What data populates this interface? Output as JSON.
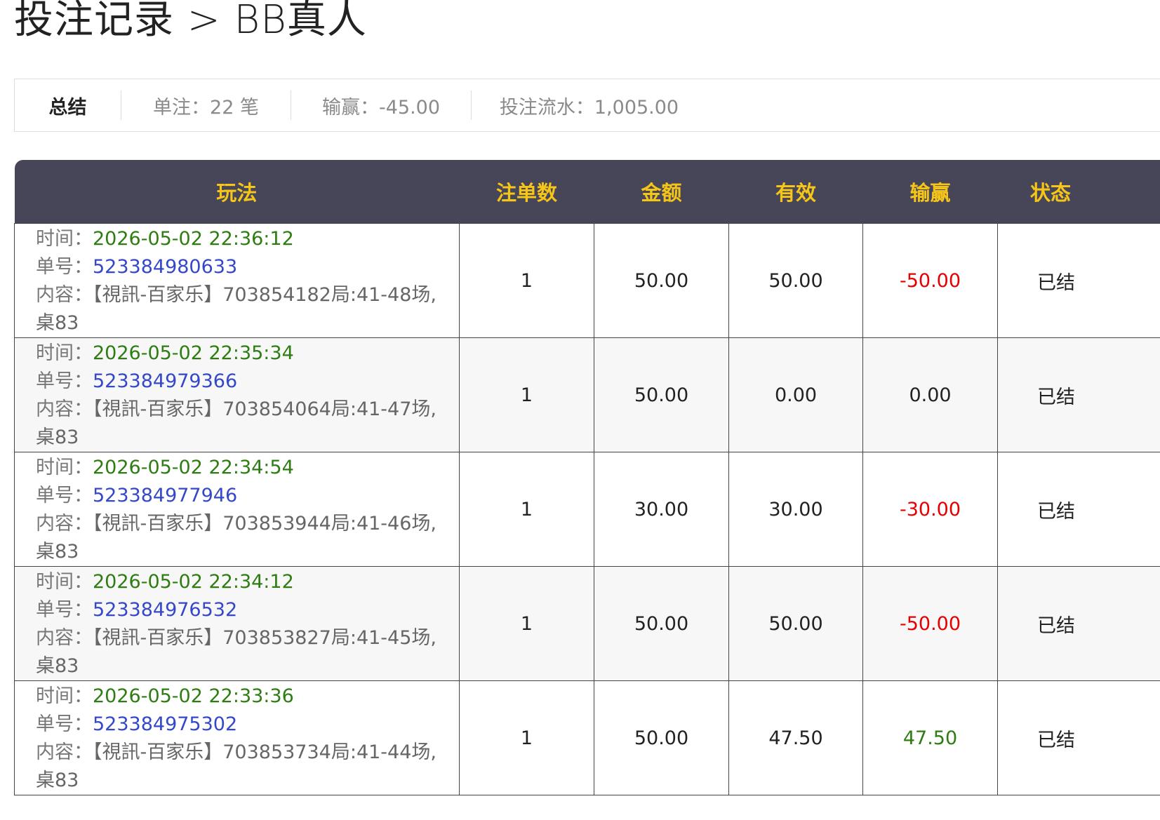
{
  "page_title": "投注记录 > BB真人",
  "summary": {
    "label": "总结",
    "bets": "单注：22 笔",
    "winloss": "输赢：-45.00",
    "turnover": "投注流水：1,005.00"
  },
  "table": {
    "headers": [
      "玩法",
      "注单数",
      "金额",
      "有效",
      "输赢",
      "状态"
    ],
    "time_label": "时间：",
    "order_label": "单号：",
    "content_label": "内容：",
    "rows": [
      {
        "time": "2026-05-02 22:36:12",
        "order_no": "523384980633",
        "content": "【視訊-百家乐】703854182局:41-48场,桌83",
        "count": "1",
        "amount": "50.00",
        "valid": "50.00",
        "winloss": "-50.00",
        "winloss_sign": "negative",
        "status": "已结"
      },
      {
        "time": "2026-05-02 22:35:34",
        "order_no": "523384979366",
        "content": "【視訊-百家乐】703854064局:41-47场,桌83",
        "count": "1",
        "amount": "50.00",
        "valid": "0.00",
        "winloss": "0.00",
        "winloss_sign": "zero",
        "status": "已结"
      },
      {
        "time": "2026-05-02 22:34:54",
        "order_no": "523384977946",
        "content": "【視訊-百家乐】703853944局:41-46场,桌83",
        "count": "1",
        "amount": "30.00",
        "valid": "30.00",
        "winloss": "-30.00",
        "winloss_sign": "negative",
        "status": "已结"
      },
      {
        "time": "2026-05-02 22:34:12",
        "order_no": "523384976532",
        "content": "【視訊-百家乐】703853827局:41-45场,桌83",
        "count": "1",
        "amount": "50.00",
        "valid": "50.00",
        "winloss": "-50.00",
        "winloss_sign": "negative",
        "status": "已结"
      },
      {
        "time": "2026-05-02 22:33:36",
        "order_no": "523384975302",
        "content": "【視訊-百家乐】703853734局:41-44场,桌83",
        "count": "1",
        "amount": "50.00",
        "valid": "47.50",
        "winloss": "47.50",
        "winloss_sign": "positive",
        "status": "已结"
      }
    ]
  },
  "colors": {
    "header_bg": "#474659",
    "header_text": "#f5c518",
    "time_text": "#2e7d12",
    "order_text": "#3448c9",
    "loss_text": "#e60000",
    "win_text": "#2e7d12"
  }
}
